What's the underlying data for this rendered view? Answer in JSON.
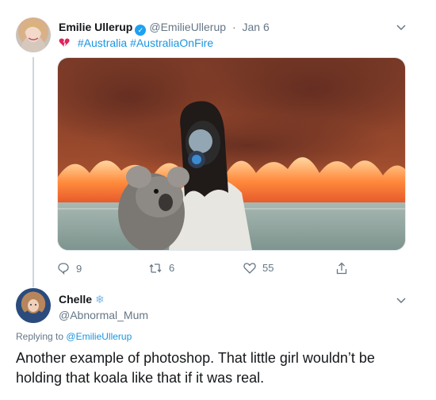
{
  "tweet_main": {
    "author_name": "Emilie Ullerup",
    "verified": true,
    "handle": "@EmilieUllerup",
    "separator": "·",
    "date": "Jan 6",
    "text_icon": "broken-heart-icon",
    "hashtags": [
      "#Australia",
      "#AustraliaOnFire"
    ],
    "image_description": "girl in gas mask holding koala in front of bushfire",
    "actions": {
      "reply_count": "9",
      "retweet_count": "6",
      "like_count": "55"
    }
  },
  "tweet_reply": {
    "author_name": "Chelle",
    "name_emoji": "❄",
    "handle": "@Abnormal_Mum",
    "replying_prefix": "Replying to",
    "replying_to": "@EmilieUllerup",
    "text": "Another example of photoshop. That little girl wouldn’t be holding that koala like that if it was real."
  },
  "colors": {
    "link": "#1b95e0",
    "verified": "#1da1f2",
    "secondary_text": "#657786",
    "primary_text": "#14171a"
  }
}
